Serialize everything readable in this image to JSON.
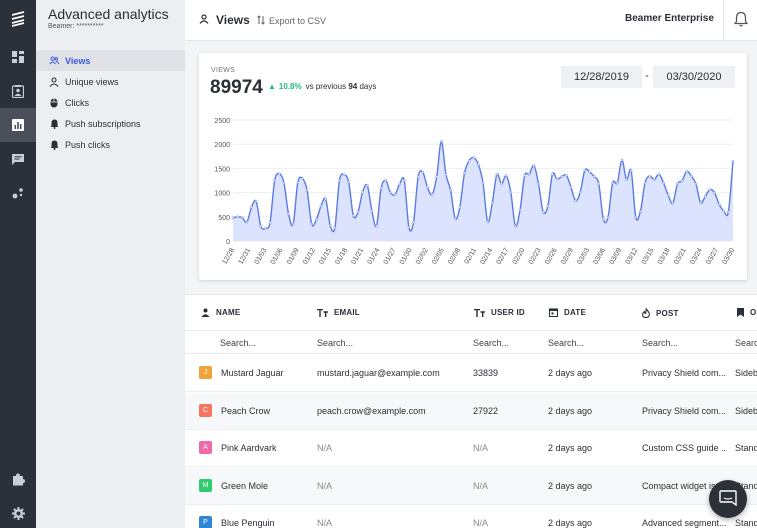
{
  "app": {
    "title": "Advanced analytics",
    "subtitle": "Beamer: **********"
  },
  "rail": {
    "items": [
      {
        "icon": "beamer-logo-icon"
      },
      {
        "icon": "dashboard-icon"
      },
      {
        "icon": "contacts-icon"
      },
      {
        "icon": "analytics-icon",
        "active": true
      },
      {
        "icon": "chat-bubble-icon"
      },
      {
        "icon": "segments-icon"
      },
      {
        "icon": "puzzle-icon"
      },
      {
        "icon": "gear-icon"
      }
    ]
  },
  "sidebar": {
    "items": [
      {
        "label": "Views",
        "icon": "people-icon",
        "active": true
      },
      {
        "label": "Unique views",
        "icon": "person-icon"
      },
      {
        "label": "Clicks",
        "icon": "mouse-icon"
      },
      {
        "label": "Push subscriptions",
        "icon": "bell-icon"
      },
      {
        "label": "Push clicks",
        "icon": "bell-icon"
      }
    ]
  },
  "topbar": {
    "title": "Views",
    "export_label": "Export to CSV",
    "brand": "Beamer Enterprise"
  },
  "stats": {
    "label": "VIEWS",
    "value": "89974",
    "delta_pct": "10.8%",
    "delta_prefix": "vs previous",
    "delta_days": "94",
    "delta_suffix": "days"
  },
  "date_range": {
    "start": "12/28/2019",
    "separator": "-",
    "end": "03/30/2020"
  },
  "colors": {
    "accent": "#3b5bdb",
    "line": "#5b7be0",
    "area": "#d6deff",
    "positive": "#1fb98a",
    "rail_bg": "#2c3039"
  },
  "chart_data": {
    "type": "area",
    "title": "",
    "xlabel": "",
    "ylabel": "",
    "ylim": [
      0,
      2500
    ],
    "yticks": [
      0,
      500,
      1000,
      1500,
      2000,
      2500
    ],
    "grid": true,
    "x_tick_labels": [
      "12/28",
      "12/31",
      "01/03",
      "01/06",
      "01/09",
      "01/12",
      "01/15",
      "01/18",
      "01/21",
      "01/24",
      "01/27",
      "01/30",
      "02/02",
      "02/05",
      "02/08",
      "02/11",
      "02/14",
      "02/17",
      "02/20",
      "02/23",
      "02/26",
      "02/29",
      "03/03",
      "03/06",
      "03/09",
      "03/12",
      "03/15",
      "03/18",
      "03/21",
      "03/24",
      "03/27",
      "03/30"
    ],
    "series": [
      {
        "values": [
          480,
          500,
          480,
          390,
          700,
          820,
          310,
          260,
          380,
          1250,
          1390,
          1200,
          560,
          350,
          1210,
          1290,
          1050,
          350,
          440,
          720,
          870,
          320,
          270,
          1250,
          1370,
          1210,
          520,
          600,
          1010,
          1150,
          620,
          310,
          1090,
          1250,
          1000,
          960,
          1180,
          1250,
          280,
          390,
          1330,
          1420,
          1110,
          960,
          1330,
          2060,
          1370,
          1050,
          460,
          700,
          1400,
          1660,
          1720,
          1580,
          1200,
          400,
          780,
          1380,
          1180,
          1350,
          1010,
          310,
          640,
          1350,
          1380,
          1560,
          1180,
          600,
          720,
          1380,
          1280,
          1330,
          1360,
          1110,
          830,
          1010,
          1460,
          1430,
          1330,
          1180,
          450,
          490,
          1200,
          1200,
          1670,
          1270,
          1450,
          490,
          610,
          1200,
          1340,
          1270,
          1380,
          1200,
          950,
          780,
          1180,
          1240,
          1440,
          1340,
          1180,
          790,
          920,
          1060,
          1000,
          760,
          620,
          600,
          1650
        ]
      }
    ]
  },
  "table": {
    "columns": [
      {
        "label": "NAME",
        "icon": "person-icon",
        "placeholder": "Search..."
      },
      {
        "label": "EMAIL",
        "icon": "text-type-icon",
        "placeholder": "Search..."
      },
      {
        "label": "USER ID",
        "icon": "text-type-icon",
        "placeholder": "Search..."
      },
      {
        "label": "DATE",
        "icon": "calendar-icon",
        "placeholder": "Search..."
      },
      {
        "label": "POST",
        "icon": "fire-icon",
        "placeholder": "Search..."
      },
      {
        "label": "O",
        "icon": "bookmark-icon",
        "placeholder": "Searc"
      }
    ],
    "rows": [
      {
        "initial": "J",
        "color": "#f0a23b",
        "name": "Mustard Jaguar",
        "email": "mustard.jaguar@example.com",
        "user_id": "33839",
        "date": "2 days ago",
        "post": "Privacy Shield com...",
        "origin": "Sideb"
      },
      {
        "initial": "C",
        "color": "#f57561",
        "name": "Peach Crow",
        "email": "peach.crow@example.com",
        "user_id": "27922",
        "date": "2 days ago",
        "post": "Privacy Shield com...",
        "origin": "Sideb"
      },
      {
        "initial": "A",
        "color": "#f16aa6",
        "name": "Pink Aardvark",
        "email": "N/A",
        "user_id": "N/A",
        "date": "2 days ago",
        "post": "Custom CSS guide ...",
        "origin": "Stand"
      },
      {
        "initial": "M",
        "color": "#2ecc71",
        "name": "Green Mole",
        "email": "N/A",
        "user_id": "N/A",
        "date": "2 days ago",
        "post": "Compact widget is...",
        "origin": "Stand"
      },
      {
        "initial": "P",
        "color": "#2f86d6",
        "name": "Blue Penguin",
        "email": "N/A",
        "user_id": "N/A",
        "date": "2 days ago",
        "post": "Advanced segment...",
        "origin": "Stand"
      }
    ]
  }
}
